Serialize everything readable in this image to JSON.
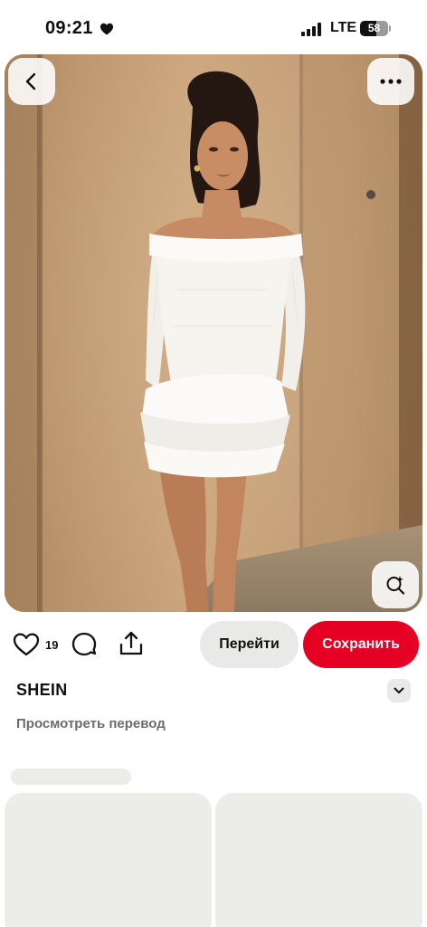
{
  "status_bar": {
    "time": "09:21",
    "network": "LTE",
    "battery": "58",
    "battery_level": 0.58
  },
  "pin": {
    "image_icons": {
      "back": "chevron-left-icon",
      "more": "more-horizontal-icon",
      "visual_search": "visual-search-icon"
    }
  },
  "actions": {
    "like_count": "19",
    "visit_label": "Перейти",
    "save_label": "Сохранить",
    "icons": {
      "like": "heart-outline-icon",
      "comment": "comment-icon",
      "share": "share-icon"
    }
  },
  "details": {
    "source": "SHEIN",
    "translate_label": "Просмотреть перевод"
  },
  "colors": {
    "save": "#e60023",
    "secondary_button": "#e9e9e7",
    "placeholder": "#ecece9"
  }
}
